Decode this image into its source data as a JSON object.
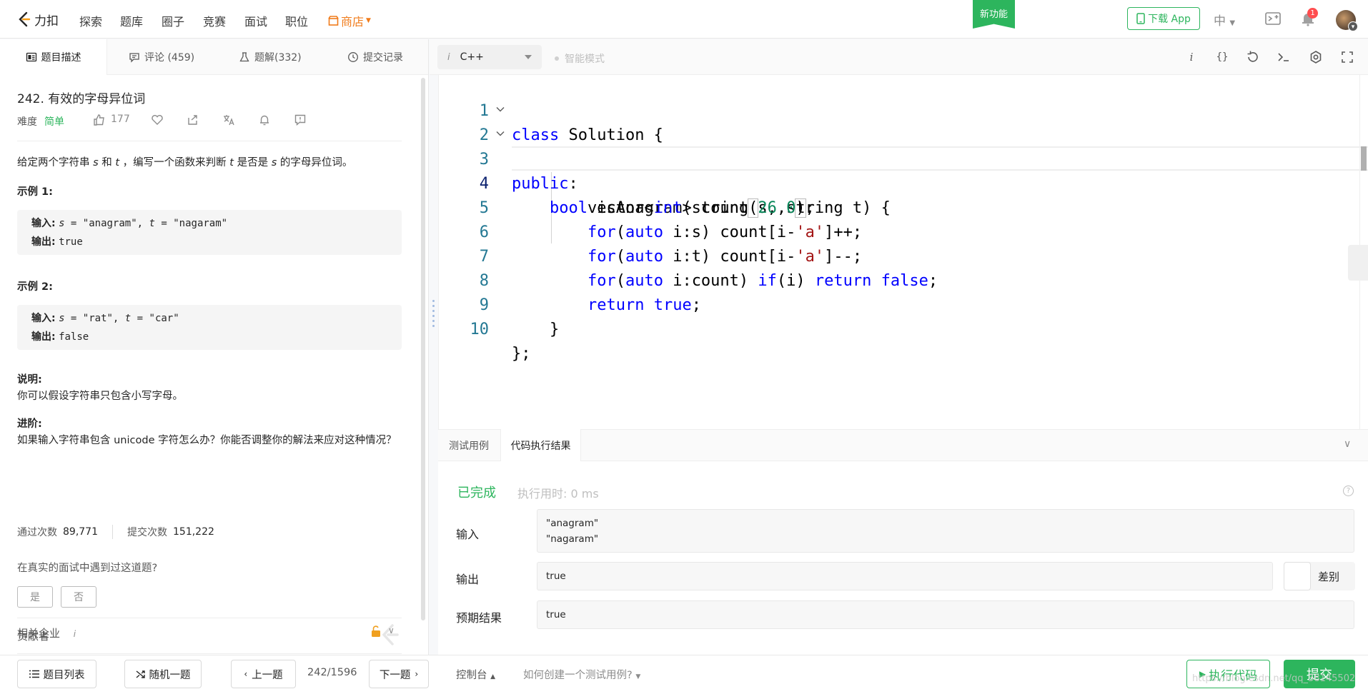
{
  "nav": {
    "brand": "力扣",
    "items": [
      "探索",
      "题库",
      "圈子",
      "竞赛",
      "面试",
      "职位"
    ],
    "store": "商店",
    "new_feature": "新功能",
    "download": "下载 App",
    "lang": "中",
    "notify_count": "1"
  },
  "left_tabs": [
    {
      "label": "题目描述"
    },
    {
      "label": "评论 (459)"
    },
    {
      "label": "题解(332)"
    },
    {
      "label": "提交记录"
    }
  ],
  "problem": {
    "title": "242. 有效的字母异位词",
    "difficulty_label": "难度",
    "difficulty": "简单",
    "likes": "177",
    "desc_a": "给定两个字符串 ",
    "desc_s1": "s",
    "desc_b": " 和 ",
    "desc_t1": "t",
    "desc_c": " ，编写一个函数来判断 ",
    "desc_t2": "t",
    "desc_d": " 是否是 ",
    "desc_s2": "s",
    "desc_e": " 的字母异位词。",
    "ex1_title": "示例 1:",
    "ex2_title": "示例 2:",
    "input_label": "输入:",
    "output_label": "输出:",
    "ex1_input_s": "s",
    "ex1_input_mid1": " = \"anagram\", ",
    "ex1_input_t": "t",
    "ex1_input_mid2": " = \"nagaram\"",
    "ex1_output": "true",
    "ex2_input_s": "s",
    "ex2_input_mid1": " = \"rat\", ",
    "ex2_input_t": "t",
    "ex2_input_mid2": " = \"car\"",
    "ex2_output": "false",
    "note_title": "说明:",
    "note": "你可以假设字符串只包含小写字母。",
    "adv_title": "进阶:",
    "adv": "如果输入字符串包含 unicode 字符怎么办？你能否调整你的解法来应对这种情况？",
    "pass_label": "通过次数",
    "pass_value": "89,771",
    "submit_label": "提交次数",
    "submit_value": "151,222",
    "ask": "在真实的面试中遇到过这道题?",
    "yes": "是",
    "no": "否",
    "contributors": "贡献者",
    "companies": "相关企业",
    "companies_info": "i"
  },
  "bottom": {
    "list": "题目列表",
    "random": "随机一题",
    "prev": "上一题",
    "page": "242/1596",
    "next": "下一题",
    "console": "控制台",
    "howto": "如何创建一个测试用例?",
    "run": "执行代码",
    "submit": "提交",
    "watermark": "https://blog.csdn.net/qq_38145502"
  },
  "editor": {
    "lang": "C++",
    "lang_icon": "i",
    "smart_mode": "智能模式",
    "line_numbers": [
      "1",
      "2",
      "3",
      "4",
      "5",
      "6",
      "7",
      "8",
      "9",
      "10"
    ]
  },
  "result": {
    "tabs": [
      "测试用例",
      "代码执行结果"
    ],
    "status": "已完成",
    "time": "执行用时: 0 ms",
    "input_label": "输入",
    "input_lines": [
      "\"anagram\"",
      "\"nagaram\""
    ],
    "output_label": "输出",
    "output": "true",
    "diff_label": "差别",
    "expected_label": "预期结果",
    "expected": "true"
  },
  "colors": {
    "accent": "#2db55d",
    "store": "#f07b1a",
    "keyword": "#0000ff",
    "number": "#09885a",
    "string": "#a31515"
  }
}
